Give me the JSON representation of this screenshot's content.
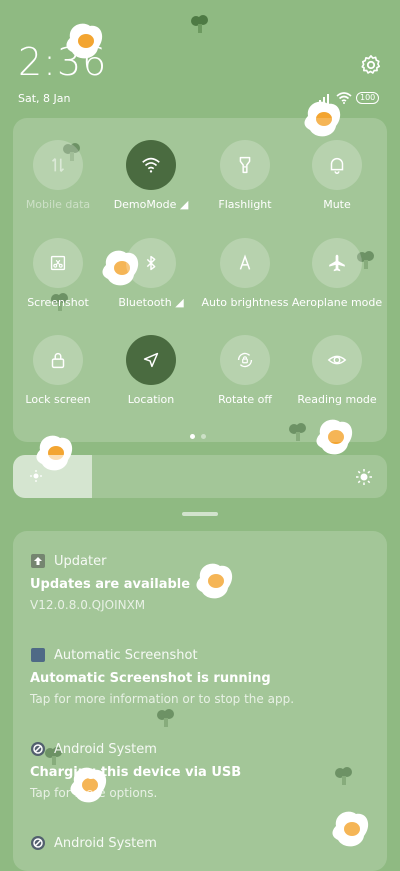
{
  "status": {
    "time": "2:36",
    "date": "Sat, 8 Jan",
    "battery": "100"
  },
  "quick_settings": [
    {
      "label": "Mobile data",
      "icon": "mobile-data-icon",
      "active": false,
      "disabled": true
    },
    {
      "label": "DemoMode ◢",
      "icon": "wifi-icon",
      "active": true,
      "disabled": false
    },
    {
      "label": "Flashlight",
      "icon": "flashlight-icon",
      "active": false,
      "disabled": false
    },
    {
      "label": "Mute",
      "icon": "bell-icon",
      "active": false,
      "disabled": false
    },
    {
      "label": "Screenshot",
      "icon": "screenshot-icon",
      "active": false,
      "disabled": false
    },
    {
      "label": "Bluetooth ◢",
      "icon": "bluetooth-icon",
      "active": false,
      "disabled": false
    },
    {
      "label": "Auto brightness",
      "icon": "auto-brightness-icon",
      "active": false,
      "disabled": false
    },
    {
      "label": "Aeroplane mode",
      "icon": "airplane-icon",
      "active": false,
      "disabled": false
    },
    {
      "label": "Lock screen",
      "icon": "lock-icon",
      "active": false,
      "disabled": false
    },
    {
      "label": "Location",
      "icon": "location-icon",
      "active": true,
      "disabled": false
    },
    {
      "label": "Rotate off",
      "icon": "rotate-lock-icon",
      "active": false,
      "disabled": false
    },
    {
      "label": "Reading mode",
      "icon": "eye-icon",
      "active": false,
      "disabled": false
    }
  ],
  "pager": {
    "current": 1,
    "total": 2
  },
  "brightness": {
    "level": 0.21
  },
  "notifications": [
    {
      "app": "Updater",
      "icon": "upload-icon",
      "title": "Updates are available",
      "body": "V12.0.8.0.QJOINXM"
    },
    {
      "app": "Automatic Screenshot",
      "icon": "screenshot-app-icon",
      "title": "Automatic Screenshot is running",
      "body": "Tap for more information or to stop the app."
    },
    {
      "app": "Android System",
      "icon": "android-system-icon",
      "title": "Charging this device via USB",
      "body": "Tap for more options."
    },
    {
      "app": "Android System",
      "icon": "android-system-icon",
      "title": "",
      "body": ""
    }
  ],
  "colors": {
    "active_tile": "#4a6b40",
    "background": "#8fba82"
  }
}
